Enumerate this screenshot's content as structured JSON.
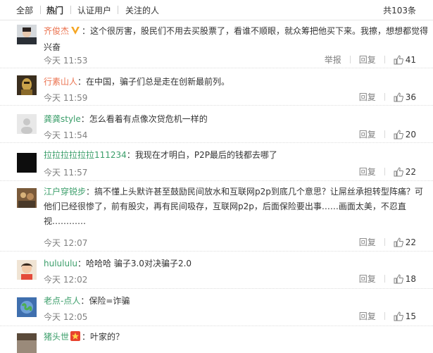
{
  "tabs": [
    {
      "label": "全部"
    },
    {
      "label": "热门"
    },
    {
      "label": "认证用户"
    },
    {
      "label": "关注的人"
    }
  ],
  "total_count": "共103条",
  "actions": {
    "report": "举报",
    "reply": "回复"
  },
  "comments": [
    {
      "user": "齐俊杰",
      "sep": "：",
      "text": "这个很厉害，股民们不用去买股票了，看谁不顺眼，就众筹把他买下来。我擦，想想都觉得兴奋",
      "time": "今天 11:53",
      "likes": "41",
      "verified": "V"
    },
    {
      "user": "行素山人",
      "sep": "：",
      "text": "在中国，骗子们总是走在创新最前列。",
      "time": "今天 11:59",
      "likes": "36"
    },
    {
      "user": "龚龚style",
      "sep": "：",
      "text": "怎么看着有点像次贷危机一样的",
      "time": "今天 11:54",
      "likes": "20"
    },
    {
      "user": "拉拉拉拉拉拉111234",
      "sep": "：",
      "text": "我现在才明白，P2P最后的钱都去哪了",
      "time": "今天 11:57",
      "likes": "22"
    },
    {
      "user": "江户穿锐步",
      "sep": "：",
      "text": "搞不懂上头默许甚至鼓励民间放水和互联网p2p到底几个意思？让屌丝承担转型阵痛？可他们已经很惨了，前有股灾，再有民间吸存，互联网p2p，后面保险要出事……画面太美，不忍直视…………",
      "time": "今天 12:07",
      "likes": "22"
    },
    {
      "user": "hulululu",
      "sep": "：",
      "text": "哈哈哈 骗子3.0对决骗子2.0",
      "time": "今天 12:02",
      "likes": "18"
    },
    {
      "user": "老点-点人",
      "sep": "：",
      "text": "保险=诈骗",
      "time": "今天 12:05",
      "likes": "15"
    },
    {
      "user": "猪头世",
      "sep": "：",
      "text": "叶家的？",
      "time": "",
      "likes": ""
    }
  ],
  "colors": {
    "username": "#eb7350",
    "muted": "#808080",
    "text": "#333333"
  }
}
